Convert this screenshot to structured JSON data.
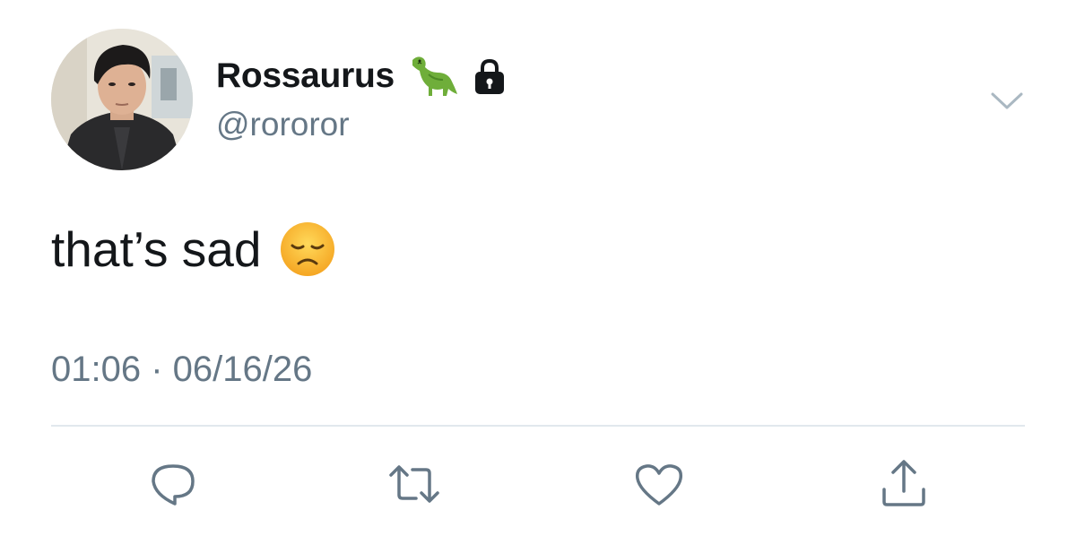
{
  "tweet": {
    "display_name": "Rossaurus",
    "handle": "@rororor",
    "name_emoji": "sauropod-dinosaur",
    "protected_icon": "lock-icon",
    "text": "that’s sad",
    "text_emoji": "disappointed-face",
    "timestamp": "01:06 · 06/16/26"
  },
  "actions": {
    "reply": "reply-icon",
    "retweet": "retweet-icon",
    "like": "heart-icon",
    "share": "share-icon"
  },
  "colors": {
    "text_primary": "#14171a",
    "text_secondary": "#657786",
    "divider": "#e1e8ed",
    "icon": "#657786"
  }
}
